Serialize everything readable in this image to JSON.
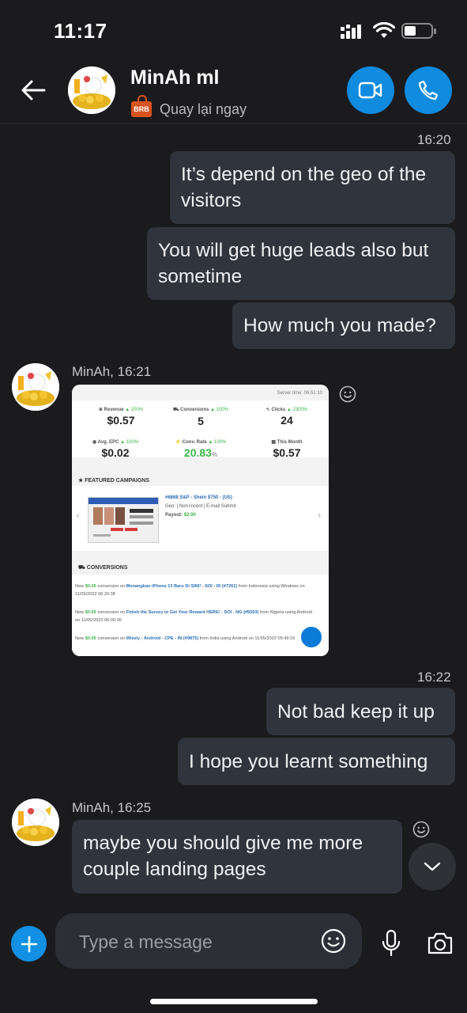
{
  "status_bar": {
    "time": "11:17"
  },
  "header": {
    "contact_name": "MinAh ml",
    "presence_badge": "BRB",
    "presence_text": "Quay lại ngay",
    "icons": [
      "back-arrow-icon",
      "video-call-icon",
      "phone-call-icon"
    ],
    "accent_color": "#0f8be0"
  },
  "messages": {
    "ts1": "16:20",
    "out1": "It’s depend on the geo of the visitors",
    "out2": "You will get huge leads also but sometime",
    "out3": "How much you made?",
    "in_sender1": "MinAh, 16:21",
    "ts2": "16:22",
    "out4": "Not bad keep it up",
    "out5": "I hope you learnt something",
    "in_sender2": "MinAh, 16:25",
    "in_text2": "maybe you should give me more couple landing pages"
  },
  "attachment": {
    "server_time": "Server time: 06:51:10",
    "stats": [
      {
        "label": "Revenue",
        "delta": "▲ 100%",
        "value": "$0.57"
      },
      {
        "label": "Conversions",
        "delta": "▲ 100%",
        "value": "5"
      },
      {
        "label": "Clicks",
        "delta": "▲ 2300%",
        "value": "24"
      },
      {
        "label": "Avg. EPC",
        "delta": "▲ 100%",
        "value": "$0.02"
      },
      {
        "label": "Conv. Rate",
        "delta": "▲ 100%",
        "value": "20.83",
        "unit": "%"
      },
      {
        "label": "This Month",
        "delta": "",
        "value": "$0.57"
      }
    ],
    "featured_title": "FEATURED CAMPAIGNS",
    "campaign": {
      "title": "#6868 S&P - Shein $750 - (US)",
      "geo": "Geo: | Non-Incent | E-mail Submit",
      "payout_label": "Payout:",
      "payout": "$2.00"
    },
    "conversions_title": "CONVERSIONS",
    "conversions": [
      {
        "prefix": "New",
        "amount": "$0.05",
        "mid": "conversion on",
        "campaign": "Menangkan iPhone 13 Baru Di SINI! - SOI - ID (#7261)",
        "suffix": "from Indonesia using Windows on 11/05/2022 06:20:38"
      },
      {
        "prefix": "New",
        "amount": "$0.05",
        "mid": "conversion on",
        "campaign": "Finish the Survey to Get Your Reward HERE! - SOI - NG (#5503)",
        "suffix": "from Nigeria using Android on 11/05/2022 06:00:36"
      },
      {
        "prefix": "New",
        "amount": "$0.05",
        "mid": "conversion on",
        "campaign": "Wizely - Android - CPE - IN (#9875)",
        "suffix": "from India using Android on 11/05/2022 05:49:16"
      }
    ]
  },
  "composer": {
    "placeholder": "Type a message",
    "icons": [
      "add-icon",
      "emoji-icon",
      "microphone-icon",
      "camera-icon",
      "chevron-down-icon"
    ]
  }
}
